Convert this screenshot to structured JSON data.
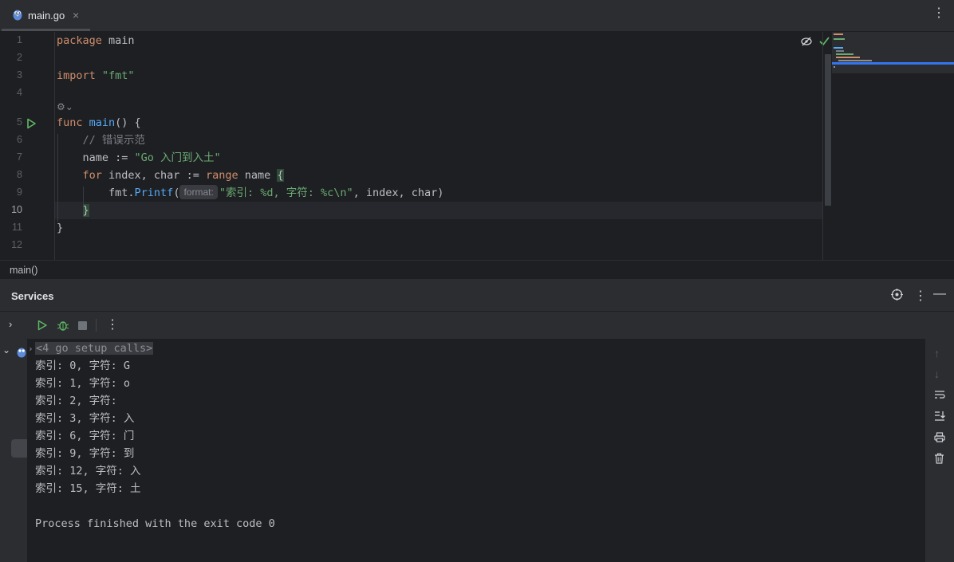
{
  "tab": {
    "filename": "main.go",
    "close": "×"
  },
  "toolbar": {
    "more": "⋮"
  },
  "editor": {
    "line_numbers": [
      "1",
      "2",
      "3",
      "4",
      "5",
      "6",
      "7",
      "8",
      "9",
      "10",
      "11",
      "12"
    ],
    "current_line": "10",
    "lines": {
      "l1": {
        "kw": "package",
        "id": "main"
      },
      "l3": {
        "kw": "import",
        "str": "\"fmt\""
      },
      "l5": {
        "kw": "func",
        "fn": "main",
        "rest": "() {"
      },
      "l6": {
        "comment": "// 错误示范"
      },
      "l7": {
        "id": "name := ",
        "str": "\"Go 入门到入土\""
      },
      "l8": {
        "kw": "for",
        "mid": " index, char := ",
        "kw2": "range",
        "end": " name ",
        "brace": "{"
      },
      "l9": {
        "call": "fmt.",
        "fn": "Printf",
        "paren": "(",
        "hint": "format:",
        "str": "\"索引: %d, 字符: %c\\n\"",
        "rest": ", index, char)"
      },
      "l10": {
        "brace": "}"
      },
      "l11": {
        "brace": "}"
      }
    },
    "reader_mode_icon": "eye-slash-icon",
    "status_icon": "check-icon"
  },
  "breadcrumb": {
    "item": "main()"
  },
  "services": {
    "title": "Services",
    "console": {
      "setup_calls": "<4 go setup calls>",
      "output": [
        "索引: 0, 字符: G",
        "索引: 1, 字符: o",
        "索引: 2, 字符:  ",
        "索引: 3, 字符: 入",
        "索引: 6, 字符: 门",
        "索引: 9, 字符: 到",
        "索引: 12, 字符: 入",
        "索引: 15, 字符: 土"
      ],
      "exit_message": "Process finished with the exit code 0"
    }
  },
  "colors": {
    "keyword": "#cf8e6d",
    "function": "#56a8f5",
    "string": "#6aab73",
    "comment": "#7a7e85",
    "run": "#5fb865"
  }
}
